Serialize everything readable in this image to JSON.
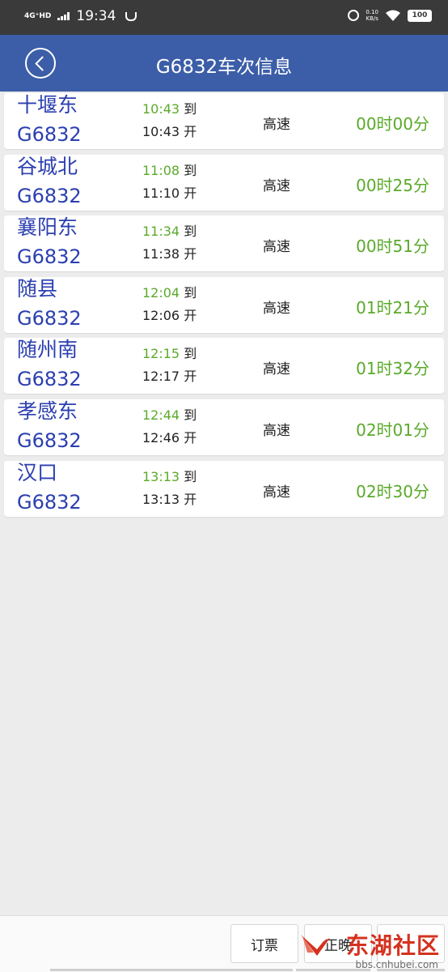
{
  "status_bar": {
    "network": "4G⁺HD",
    "time": "19:34",
    "speed_value": "0.10",
    "speed_unit": "KB/s",
    "battery": "100"
  },
  "header": {
    "title": "G6832车次信息"
  },
  "stops": [
    {
      "station": "十堰东",
      "train": "G6832",
      "arrive": "10:43",
      "arrive_label": "到",
      "depart": "10:43",
      "depart_label": "开",
      "type": "高速",
      "duration": "00时00分"
    },
    {
      "station": "谷城北",
      "train": "G6832",
      "arrive": "11:08",
      "arrive_label": "到",
      "depart": "11:10",
      "depart_label": "开",
      "type": "高速",
      "duration": "00时25分"
    },
    {
      "station": "襄阳东",
      "train": "G6832",
      "arrive": "11:34",
      "arrive_label": "到",
      "depart": "11:38",
      "depart_label": "开",
      "type": "高速",
      "duration": "00时51分"
    },
    {
      "station": "随县",
      "train": "G6832",
      "arrive": "12:04",
      "arrive_label": "到",
      "depart": "12:06",
      "depart_label": "开",
      "type": "高速",
      "duration": "01时21分"
    },
    {
      "station": "随州南",
      "train": "G6832",
      "arrive": "12:15",
      "arrive_label": "到",
      "depart": "12:17",
      "depart_label": "开",
      "type": "高速",
      "duration": "01时32分"
    },
    {
      "station": "孝感东",
      "train": "G6832",
      "arrive": "12:44",
      "arrive_label": "到",
      "depart": "12:46",
      "depart_label": "开",
      "type": "高速",
      "duration": "02时01分"
    },
    {
      "station": "汉口",
      "train": "G6832",
      "arrive": "13:13",
      "arrive_label": "到",
      "depart": "13:13",
      "depart_label": "开",
      "type": "高速",
      "duration": "02时30分"
    }
  ],
  "bottom": {
    "book_label": "订票",
    "late_label": "正晚"
  },
  "watermark": {
    "brand": "东湖社区",
    "url": "bbs.cnhubei.com"
  },
  "colors": {
    "header_bg": "#3c5ea8",
    "station_text": "#2b3fb0",
    "time_green": "#5aaa2a",
    "watermark_red": "#d4321f"
  }
}
